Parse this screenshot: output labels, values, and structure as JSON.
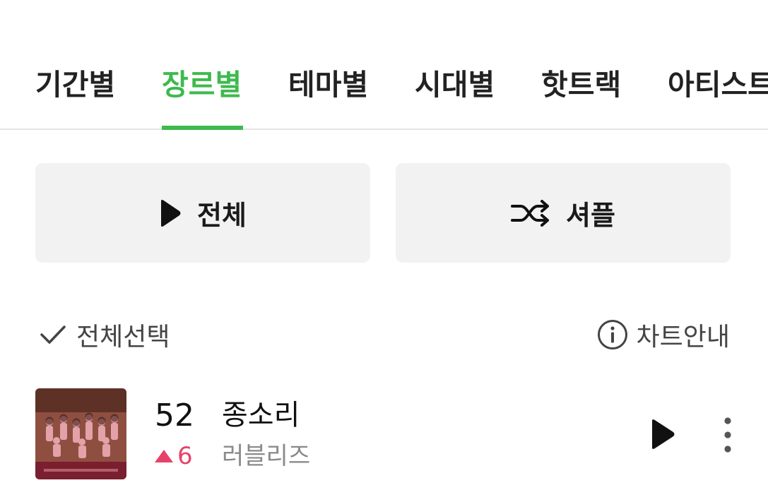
{
  "tabs": [
    {
      "label": "기간별",
      "active": false
    },
    {
      "label": "장르별",
      "active": true
    },
    {
      "label": "테마별",
      "active": false
    },
    {
      "label": "시대별",
      "active": false
    },
    {
      "label": "핫트랙",
      "active": false
    },
    {
      "label": "아티스트",
      "active": false
    }
  ],
  "actions": {
    "play_all_label": "전체",
    "shuffle_label": "셔플"
  },
  "controls": {
    "select_all_label": "전체선택",
    "chart_info_label": "차트안내"
  },
  "track": {
    "rank": "52",
    "change_direction": "up",
    "change": "6",
    "title": "종소리",
    "artist": "러블리즈"
  },
  "colors": {
    "accent": "#3dba4d",
    "rank_up": "#e8416a",
    "button_bg": "#f2f2f2"
  },
  "icons": {
    "play_all": "play-icon",
    "shuffle": "shuffle-icon",
    "select_all": "check-icon",
    "chart_info": "info-icon",
    "track_play": "play-icon",
    "more": "more-vertical-icon"
  }
}
